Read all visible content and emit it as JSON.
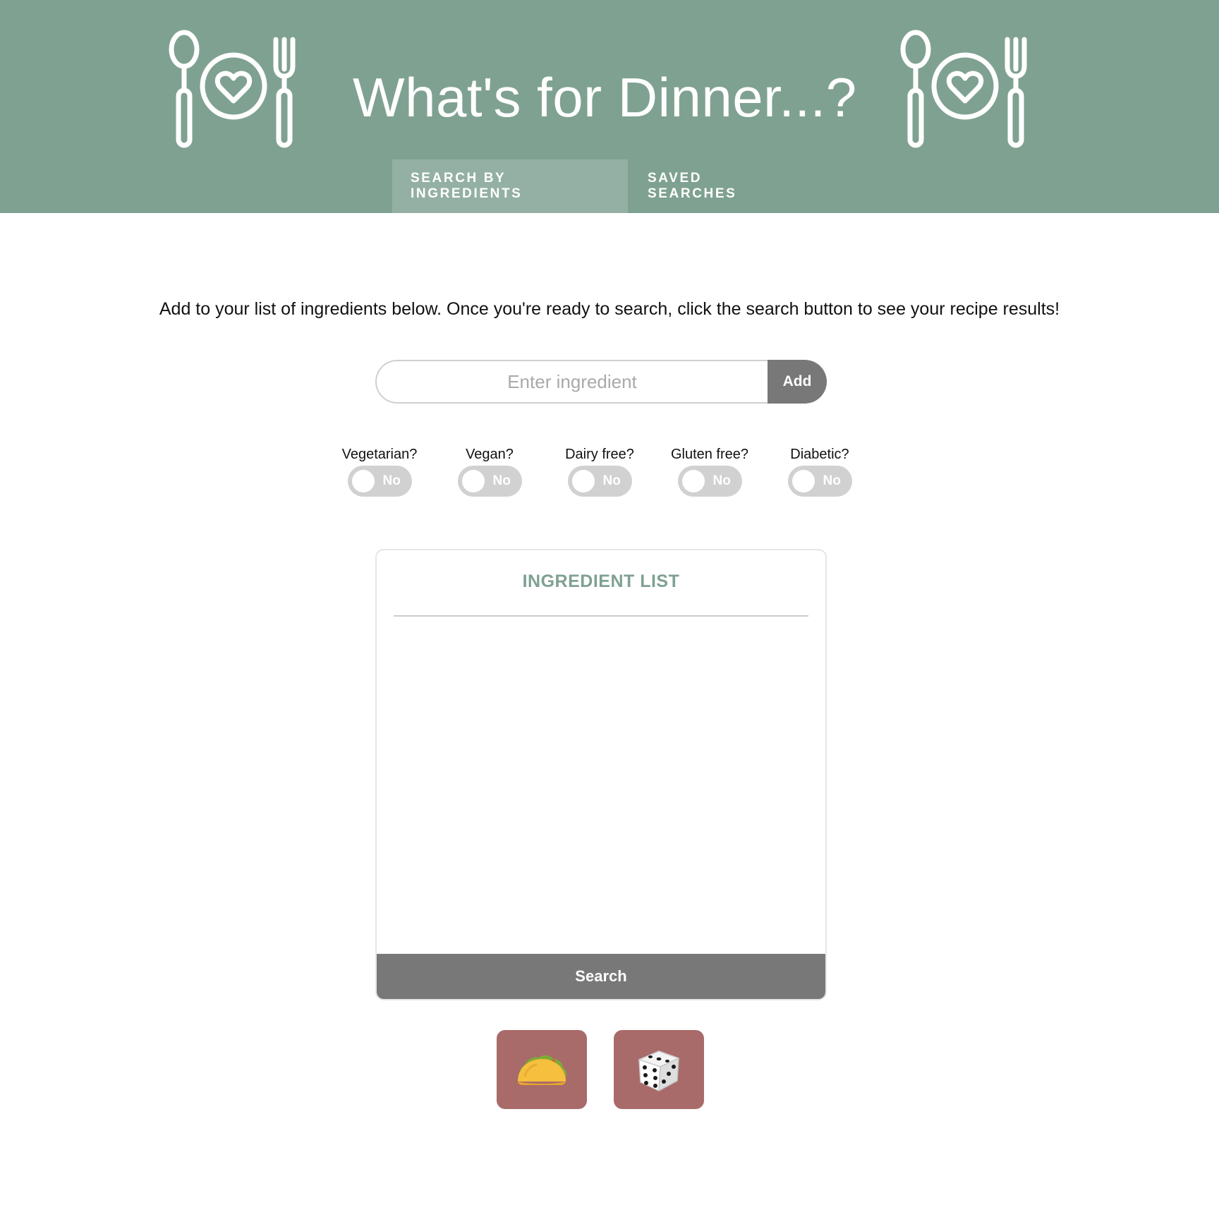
{
  "header": {
    "title": "What's for Dinner...?",
    "left_icon": "spoon-plate-fork-icon",
    "right_icon": "spoon-plate-fork-icon",
    "background_color": "#7fa191"
  },
  "tabs": [
    {
      "label": "SEARCH BY INGREDIENTS",
      "active": true
    },
    {
      "label": "SAVED SEARCHES",
      "active": false
    }
  ],
  "intro": {
    "text": "Add to your list of ingredients below. Once you're ready to search, click the search button to see your recipe results!"
  },
  "ingredient_input": {
    "value": "",
    "placeholder": "Enter ingredient",
    "add_label": "Add"
  },
  "filters": [
    {
      "label": "Vegetarian?",
      "state": "No"
    },
    {
      "label": "Vegan?",
      "state": "No"
    },
    {
      "label": "Dairy free?",
      "state": "No"
    },
    {
      "label": "Gluten free?",
      "state": "No"
    },
    {
      "label": "Diabetic?",
      "state": "No"
    }
  ],
  "ingredient_list": {
    "title": "INGREDIENT LIST",
    "items": [],
    "search_label": "Search",
    "title_color": "#7fa191"
  },
  "action_buttons": [
    {
      "icon": "taco-icon"
    },
    {
      "icon": "dice-icon"
    }
  ],
  "colors": {
    "primary": "#7fa191",
    "active_tab": "#94b0a4",
    "button_gray": "#787878",
    "toggle_off": "#d1d1d1",
    "action_button": "#a86b6a"
  }
}
